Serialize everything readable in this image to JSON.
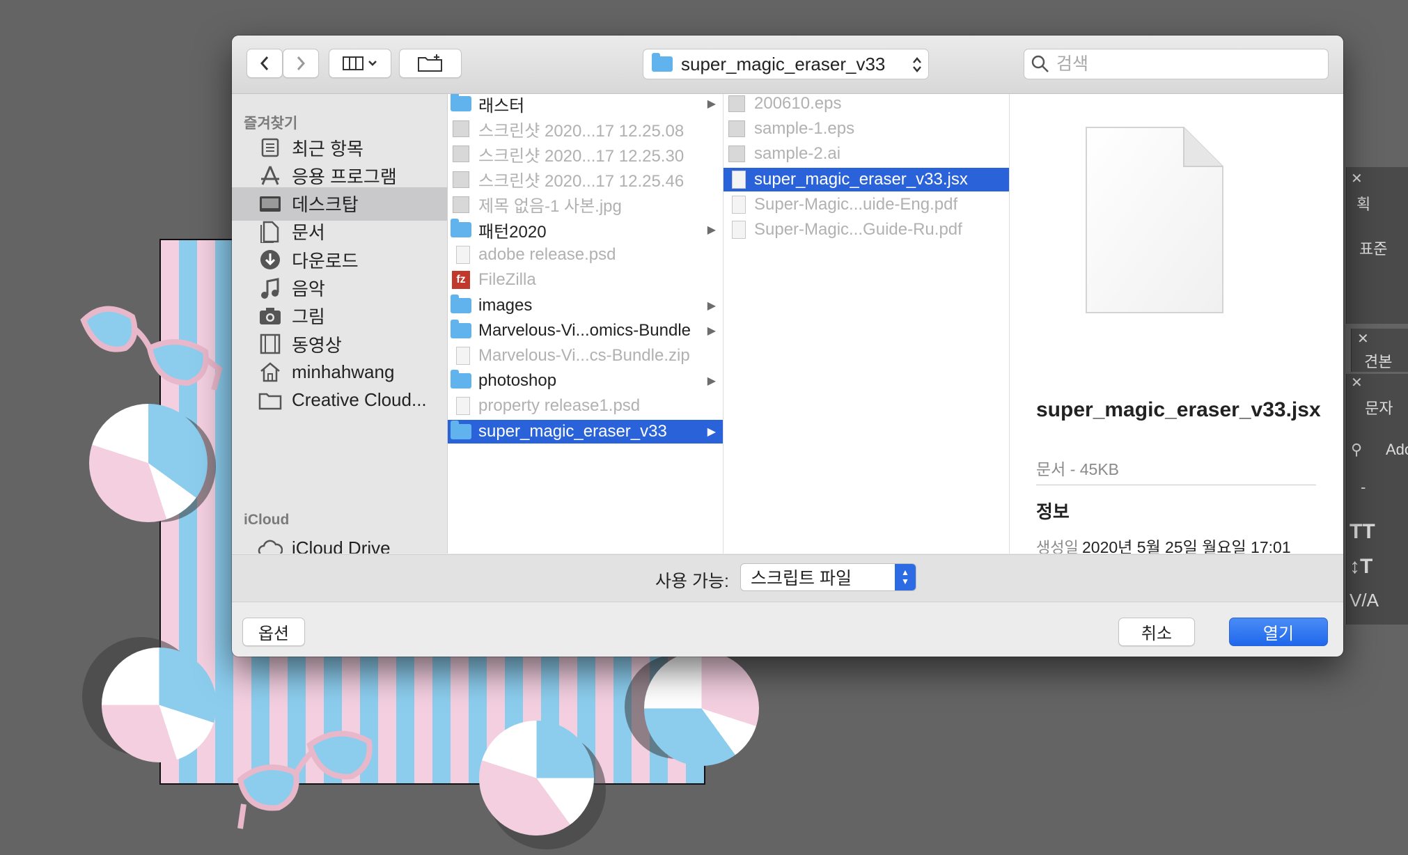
{
  "toolbar": {
    "path_label": "super_magic_eraser_v33",
    "search_placeholder": "검색"
  },
  "sidebar": {
    "favorites_header": "즐겨찾기",
    "items": [
      {
        "label": "최근 항목",
        "icon": "recents-icon"
      },
      {
        "label": "응용 프로그램",
        "icon": "applications-icon"
      },
      {
        "label": "데스크탑",
        "icon": "desktop-icon",
        "selected": true
      },
      {
        "label": "문서",
        "icon": "documents-icon"
      },
      {
        "label": "다운로드",
        "icon": "downloads-icon"
      },
      {
        "label": "음악",
        "icon": "music-icon"
      },
      {
        "label": "그림",
        "icon": "pictures-icon"
      },
      {
        "label": "동영상",
        "icon": "movies-icon"
      },
      {
        "label": "minhahwang",
        "icon": "home-icon"
      },
      {
        "label": "Creative Cloud...",
        "icon": "folder-icon"
      }
    ],
    "icloud_header": "iCloud",
    "icloud_items": [
      {
        "label": "iCloud Drive",
        "icon": "cloud-icon"
      }
    ]
  },
  "column1": [
    {
      "name": "래스터",
      "type": "folder",
      "has_children": true
    },
    {
      "name": "스크린샷 2020...17 12.25.08",
      "type": "image",
      "dim": true
    },
    {
      "name": "스크린샷 2020...17 12.25.30",
      "type": "image",
      "dim": true
    },
    {
      "name": "스크린샷 2020...17 12.25.46",
      "type": "image",
      "dim": true
    },
    {
      "name": "제목 없음-1 사본.jpg",
      "type": "image",
      "dim": true
    },
    {
      "name": "패턴2020",
      "type": "folder",
      "has_children": true
    },
    {
      "name": "adobe release.psd",
      "type": "doc",
      "dim": true
    },
    {
      "name": "FileZilla",
      "type": "app",
      "dim": true
    },
    {
      "name": "images",
      "type": "folder",
      "has_children": true
    },
    {
      "name": "Marvelous-Vi...omics-Bundle",
      "type": "folder",
      "has_children": true
    },
    {
      "name": "Marvelous-Vi...cs-Bundle.zip",
      "type": "doc",
      "dim": true
    },
    {
      "name": "photoshop",
      "type": "folder",
      "has_children": true
    },
    {
      "name": "property release1.psd",
      "type": "doc",
      "dim": true
    },
    {
      "name": "super_magic_eraser_v33",
      "type": "folder",
      "has_children": true,
      "selected": true
    }
  ],
  "column2": [
    {
      "name": "200610.eps",
      "type": "image",
      "dim": true
    },
    {
      "name": "sample-1.eps",
      "type": "image",
      "dim": true
    },
    {
      "name": "sample-2.ai",
      "type": "image",
      "dim": true
    },
    {
      "name": "super_magic_eraser_v33.jsx",
      "type": "doc",
      "selected": true
    },
    {
      "name": "Super-Magic...uide-Eng.pdf",
      "type": "doc",
      "dim": true
    },
    {
      "name": "Super-Magic...Guide-Ru.pdf",
      "type": "doc",
      "dim": true
    }
  ],
  "preview": {
    "title": "super_magic_eraser_v33.jsx",
    "subtitle": "문서 - 45KB",
    "info_header": "정보",
    "created_label": "생성일",
    "created_value": "2020년 5월 25일 월요일 17:01"
  },
  "filter": {
    "label": "사용 가능:",
    "value": "스크립트 파일"
  },
  "buttons": {
    "options": "옵션",
    "cancel": "취소",
    "open": "열기"
  },
  "right_panels": {
    "panel1_tab": "획",
    "panel1_value": "표준",
    "panel2_tab": "견본",
    "panel3_tab": "문자",
    "font_field": "Ado",
    "style_field": "-"
  },
  "colors": {
    "selection": "#2a63d9",
    "primary_button": "#1f68ec",
    "folder": "#61b3ee",
    "background": "#646464"
  }
}
